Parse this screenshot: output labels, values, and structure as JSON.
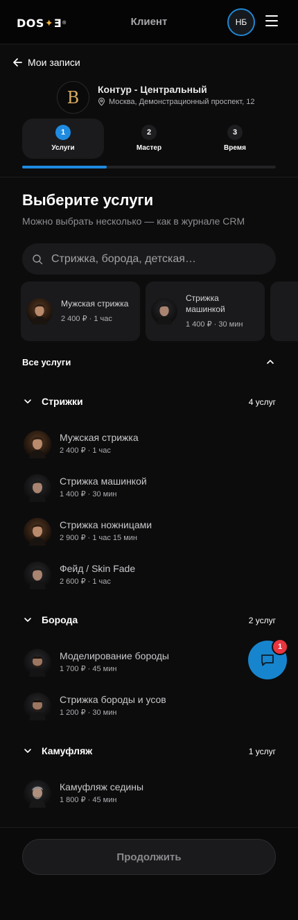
{
  "header": {
    "logo_left": "DOS",
    "logo_star": "✦",
    "logo_right": "Ǝ",
    "logo_reg": "®",
    "title": "Клиент",
    "avatar_initials": "НБ"
  },
  "nav": {
    "back_label": "Мои записи"
  },
  "salon": {
    "logo_letter": "B",
    "name": "Контур - Центральный",
    "address": "Москва, Демонстрационный проспект, 12"
  },
  "steps": [
    {
      "num": "1",
      "label": "Услуги",
      "active": true
    },
    {
      "num": "2",
      "label": "Мастер",
      "active": false
    },
    {
      "num": "3",
      "label": "Время",
      "active": false
    }
  ],
  "progress_fraction": 0.333,
  "page": {
    "title": "Выберите услуги",
    "subtitle": "Можно выбрать несколько — как в журнале CRM"
  },
  "search": {
    "placeholder": "Стрижка, борода, детская…",
    "value": ""
  },
  "popular": [
    {
      "title": "Мужская стрижка",
      "meta": "2 400 ₽ · 1 час"
    },
    {
      "title": "Стрижка машинкой",
      "meta": "1 400 ₽ · 30 мин"
    }
  ],
  "all_services_label": "Все услуги",
  "categories": [
    {
      "title": "Стрижки",
      "count": "4 услуг",
      "items": [
        {
          "title": "Мужская стрижка",
          "meta": "2 400 ₽ · 1 час"
        },
        {
          "title": "Стрижка машинкой",
          "meta": "1 400 ₽ · 30 мин"
        },
        {
          "title": "Стрижка ножницами",
          "meta": "2 900 ₽ · 1 час 15 мин"
        },
        {
          "title": "Фейд / Skin Fade",
          "meta": "2 600 ₽ · 1 час"
        }
      ]
    },
    {
      "title": "Борода",
      "count": "2 услуг",
      "items": [
        {
          "title": "Моделирование бороды",
          "meta": "1 700 ₽ · 45 мин"
        },
        {
          "title": "Стрижка бороды и усов",
          "meta": "1 200 ₽ · 30 мин"
        }
      ]
    },
    {
      "title": "Камуфляж",
      "count": "1 услуг",
      "items": [
        {
          "title": "Камуфляж седины",
          "meta": "1 800 ₽ · 45 мин"
        }
      ]
    }
  ],
  "chat": {
    "badge": "1"
  },
  "continue_label": "Продолжить",
  "colors": {
    "accent": "#1f8be0",
    "badge": "#e8353f",
    "logo_gold": "#d9ac62",
    "background": "#0c0c0d"
  }
}
